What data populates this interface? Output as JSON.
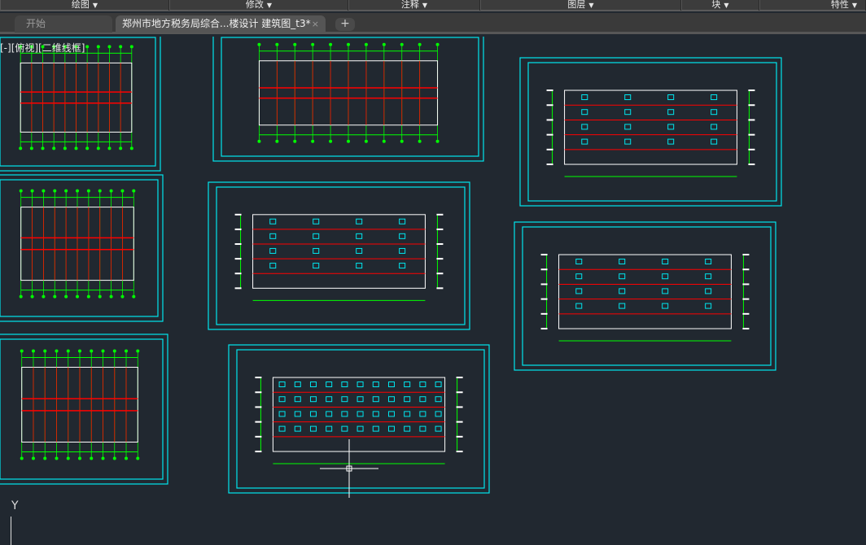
{
  "ribbon": {
    "panels": [
      {
        "label": "绘图",
        "icon": "dropdown-arrow-icon"
      },
      {
        "label": "修改",
        "icon": "dropdown-arrow-icon"
      },
      {
        "label": "注释",
        "icon": "dropdown-arrow-icon"
      },
      {
        "label": "图层",
        "icon": "dropdown-arrow-icon"
      },
      {
        "label": "块",
        "icon": "dropdown-arrow-icon"
      },
      {
        "label": "特性",
        "icon": "dropdown-arrow-icon"
      }
    ]
  },
  "tabs": [
    {
      "label": "开始"
    },
    {
      "label": "郑州市地方税务局综合...楼设计 建筑图_t3*",
      "close": "×"
    }
  ],
  "add_tab": "+",
  "viewport_label": "[-][俯视][二维线框]",
  "ucs_label": "Y",
  "colors": {
    "canvas": "#212830",
    "sheet_border": "#00e5ee",
    "dimension": "#00ff00",
    "floor_line": "#ff0000",
    "window": "#00e5ee",
    "outline": "#ffffff"
  }
}
